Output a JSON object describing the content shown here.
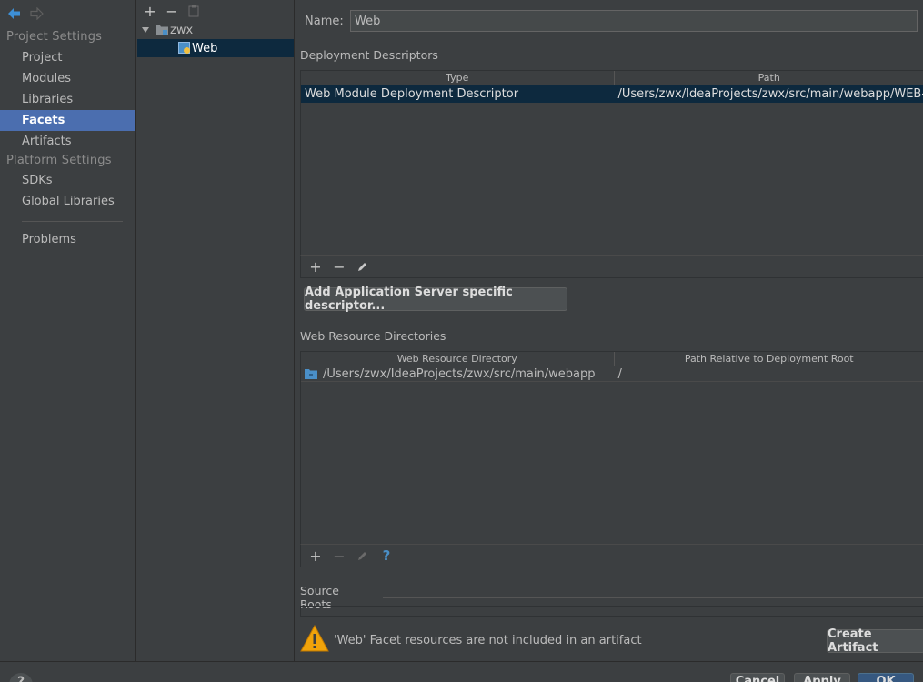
{
  "nav": {
    "project_settings_label": "Project Settings",
    "project_items": [
      "Project",
      "Modules",
      "Libraries",
      "Facets",
      "Artifacts"
    ],
    "selected_item": "Facets",
    "platform_settings_label": "Platform Settings",
    "platform_items": [
      "SDKs",
      "Global Libraries"
    ],
    "problems_label": "Problems"
  },
  "tree": {
    "toolbar": [
      "add-icon",
      "remove-icon",
      "copy-icon"
    ],
    "add_glyph": "+",
    "remove_glyph": "−",
    "root_label": "zwx",
    "child_label": "Web"
  },
  "facet": {
    "name_label": "Name:",
    "name_value": "Web"
  },
  "deployment": {
    "title": "Deployment Descriptors",
    "columns": [
      "Type",
      "Path"
    ],
    "rows": [
      {
        "type": "Web Module Deployment Descriptor",
        "path": "/Users/zwx/IdeaProjects/zwx/src/main/webapp/WEB-INF/web.xml"
      }
    ],
    "toolbar": [
      "add-icon",
      "remove-icon",
      "edit-icon"
    ],
    "add_server_button": "Add Application Server specific descriptor..."
  },
  "web_resources": {
    "title": "Web Resource Directories",
    "columns": [
      "Web Resource Directory",
      "Path Relative to Deployment Root"
    ],
    "rows": [
      {
        "directory": "/Users/zwx/IdeaProjects/zwx/src/main/webapp",
        "relative": "/"
      }
    ],
    "toolbar": [
      "add-icon",
      "remove-icon",
      "edit-icon",
      "help-icon"
    ],
    "help_glyph": "?"
  },
  "source_roots": {
    "title": "Source Roots"
  },
  "warning": {
    "text": "'Web' Facet resources are not included in an artifact",
    "button": "Create Artifact"
  },
  "dialog": {
    "help_glyph": "?",
    "cancel": "Cancel",
    "apply": "Apply",
    "ok": "OK"
  },
  "colors": {
    "selection_nav": "#4b6eaf",
    "selection_table": "#0d293e",
    "background": "#3c3f41",
    "warning_icon": "#f0a30a",
    "folder_icon": "#4a8fc7"
  }
}
